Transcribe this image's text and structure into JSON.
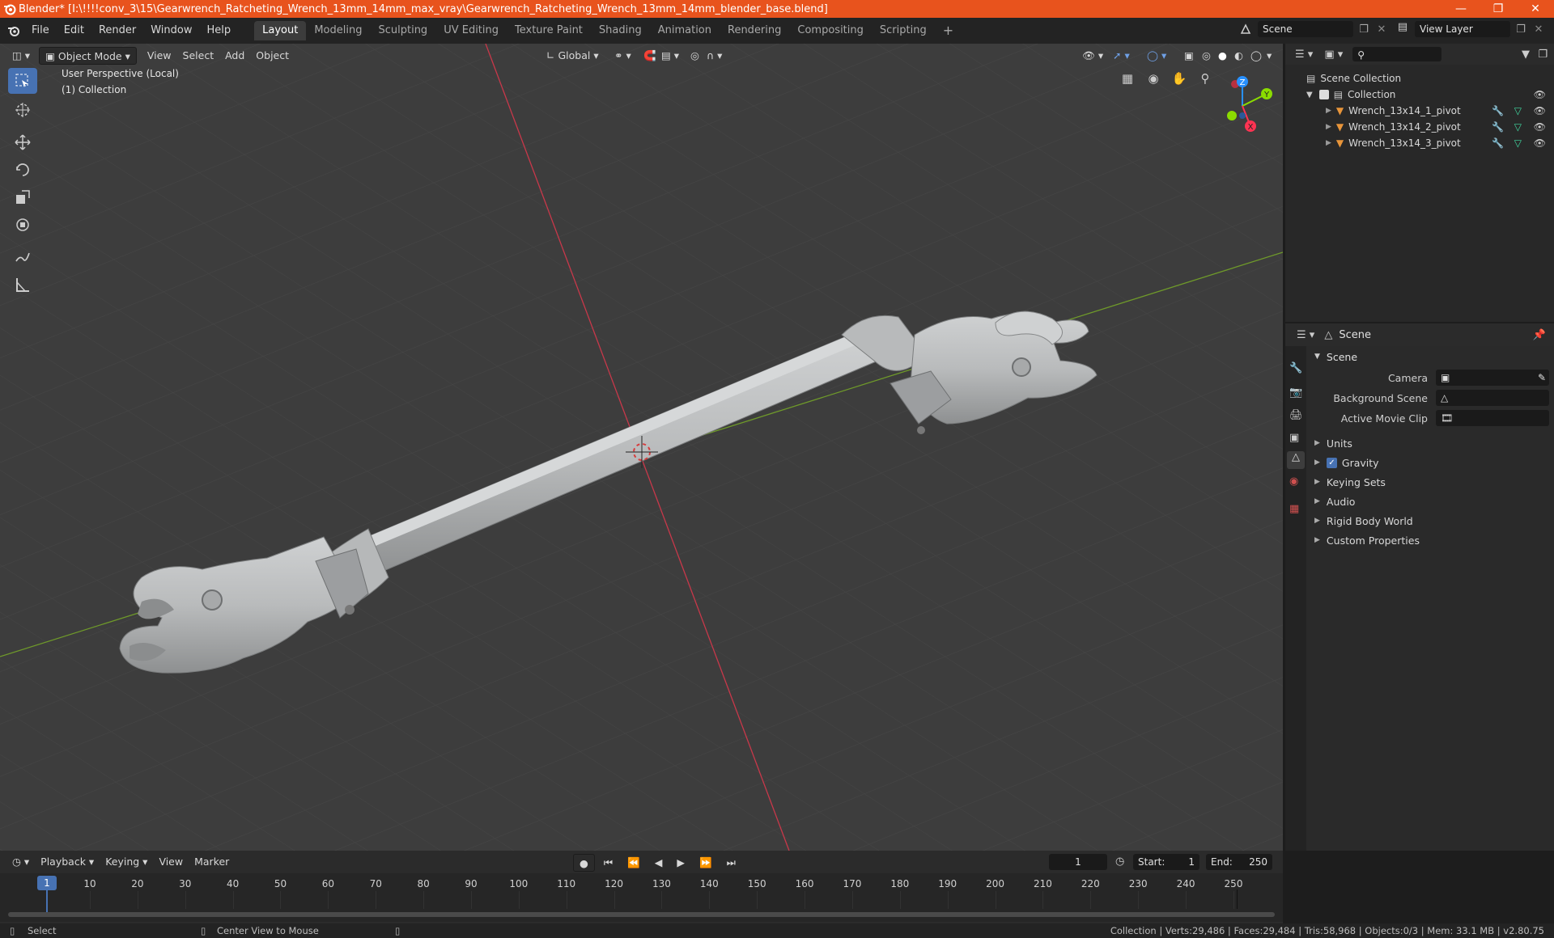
{
  "window": {
    "title": "Blender* [I:\\!!!!conv_3\\15\\Gearwrench_Ratcheting_Wrench_13mm_14mm_max_vray\\Gearwrench_Ratcheting_Wrench_13mm_14mm_blender_base.blend]"
  },
  "menubar": {
    "menus": [
      "File",
      "Edit",
      "Render",
      "Window",
      "Help"
    ],
    "workspaces": [
      "Layout",
      "Modeling",
      "Sculpting",
      "UV Editing",
      "Texture Paint",
      "Shading",
      "Animation",
      "Rendering",
      "Compositing",
      "Scripting"
    ],
    "active_workspace": "Layout",
    "scene": "Scene",
    "view_layer": "View Layer"
  },
  "viewport": {
    "mode": "Object Mode",
    "menus": [
      "View",
      "Select",
      "Add",
      "Object"
    ],
    "transform_orientation": "Global",
    "overlay_text_1": "User Perspective (Local)",
    "overlay_text_2": "(1) Collection",
    "gizmo_axes": [
      "Z",
      "Y",
      "X"
    ]
  },
  "outliner": {
    "root": "Scene Collection",
    "collection": "Collection",
    "objects": [
      "Wrench_13x14_1_pivot",
      "Wrench_13x14_2_pivot",
      "Wrench_13x14_3_pivot"
    ]
  },
  "properties": {
    "header": "Scene",
    "panel_title": "Scene",
    "fields": [
      {
        "label": "Camera",
        "value": ""
      },
      {
        "label": "Background Scene",
        "value": ""
      },
      {
        "label": "Active Movie Clip",
        "value": ""
      }
    ],
    "sections": [
      "Units",
      "Gravity",
      "Keying Sets",
      "Audio",
      "Rigid Body World",
      "Custom Properties"
    ],
    "gravity_checked": true
  },
  "timeline": {
    "menus": [
      "Playback",
      "Keying",
      "View",
      "Marker"
    ],
    "current_frame": "1",
    "start_label": "Start:",
    "start": "1",
    "end_label": "End:",
    "end": "250",
    "ticks": [
      "1",
      "10",
      "20",
      "30",
      "40",
      "50",
      "60",
      "70",
      "80",
      "90",
      "100",
      "110",
      "120",
      "130",
      "140",
      "150",
      "160",
      "170",
      "180",
      "190",
      "200",
      "210",
      "220",
      "230",
      "240",
      "250"
    ]
  },
  "statusbar": {
    "left_action": "Select",
    "middle_action": "Center View to Mouse",
    "stats": "Collection | Verts:29,486 | Faces:29,484 | Tris:58,968 | Objects:0/3 | Mem: 33.1 MB | v2.80.75"
  },
  "colors": {
    "titlebar": "#e8531d",
    "accent": "#4772b3",
    "x_axis": "#ff3352",
    "y_axis": "#8bdc00",
    "z_axis": "#2890ff"
  }
}
